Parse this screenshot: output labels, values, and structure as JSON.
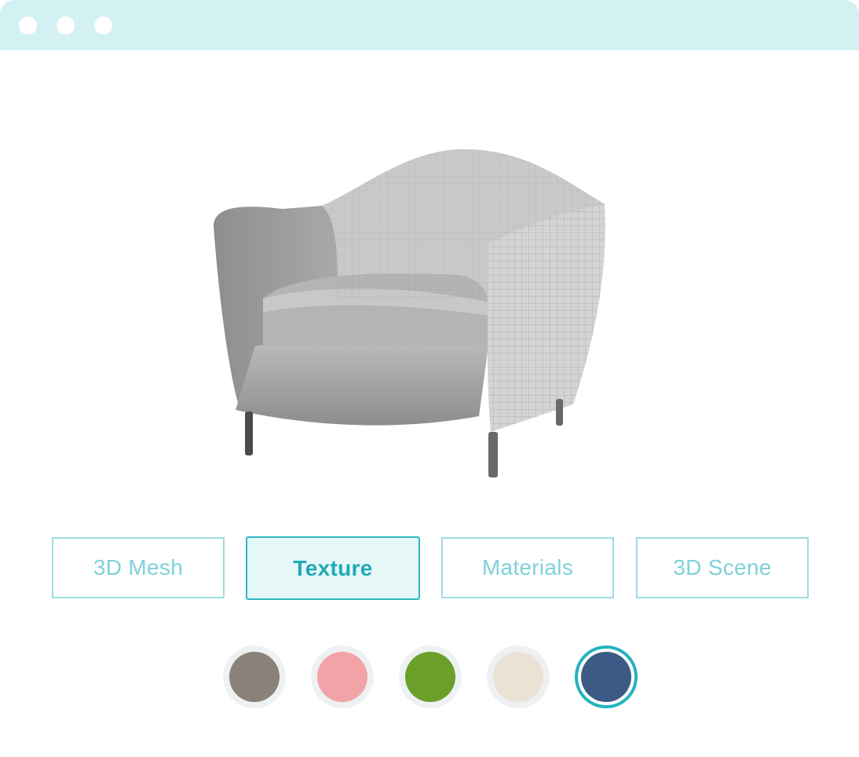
{
  "window": {
    "title_dots": [
      "dot",
      "dot",
      "dot"
    ]
  },
  "viewer": {
    "object": "armchair",
    "icon": "armchair-3d-model"
  },
  "tabs": [
    {
      "label": "3D Mesh",
      "selected": false
    },
    {
      "label": "Texture",
      "selected": true
    },
    {
      "label": "Materials",
      "selected": false
    },
    {
      "label": "3D Scene",
      "selected": false
    }
  ],
  "swatches": [
    {
      "color": "#8a8178",
      "selected": false
    },
    {
      "color": "#f2a3a8",
      "selected": false
    },
    {
      "color": "#6a9f2a",
      "selected": false
    },
    {
      "color": "#ebe2d6",
      "selected": false
    },
    {
      "color": "#3c5a86",
      "selected": true
    }
  ],
  "colors": {
    "accent": "#22b3c0",
    "titlebar": "#d3f1f3"
  }
}
